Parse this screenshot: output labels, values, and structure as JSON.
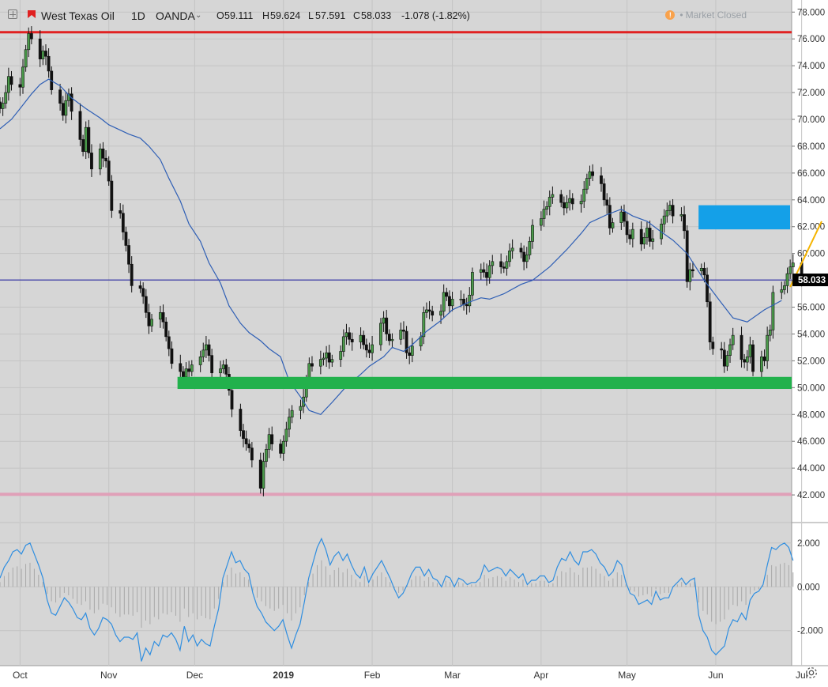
{
  "header": {
    "symbol": "West Texas Oil",
    "interval": "1D",
    "broker": "OANDA",
    "open_label": "O",
    "open": "59.111",
    "high_label": "H",
    "high": "59.624",
    "low_label": "L",
    "low": "57.591",
    "close_label": "C",
    "close": "58.033",
    "change": "-1.078 (-1.82%)",
    "market_status": "Market Closed"
  },
  "colors": {
    "background": "#d6d6d6",
    "candle_up": "#4a9a4a",
    "candle_down": "#111111",
    "ma_line": "#2f5fb5",
    "price_line": "#1a1aa0",
    "resistance_line": "#e02020",
    "support_band": "#22b14c",
    "target_box": "#14a0e8",
    "bottom_line": "#e0a0b8",
    "oscillator_line": "#2f8ee0",
    "oscillator_hist": "#a8a8a8",
    "projection_line": "#f5b400",
    "price_badge_bg": "#000000"
  },
  "chart_data": [
    {
      "type": "candlestick",
      "title": "",
      "y_axis_ticks": [
        "42.000",
        "44.000",
        "46.000",
        "48.000",
        "50.000",
        "52.000",
        "54.000",
        "56.000",
        "58.000",
        "60.000",
        "62.000",
        "64.000",
        "66.000",
        "68.000",
        "70.000",
        "72.000",
        "74.000",
        "76.000",
        "78.000"
      ],
      "x_axis_ticks": [
        "Oct",
        "Nov",
        "Dec",
        "2019",
        "Feb",
        "Mar",
        "Apr",
        "May",
        "Jun",
        "Jul"
      ],
      "ylim": [
        40.0,
        78.9
      ],
      "current_price": 58.033,
      "current_price_label": "58.033",
      "horizontal_levels": {
        "resistance": 76.5,
        "price_line": 58.03,
        "bottom": 42.05
      },
      "support_zone": [
        49.9,
        50.8
      ],
      "target_zone": [
        61.8,
        63.6
      ],
      "moving_average": [
        69.3,
        70.0,
        70.8,
        71.9,
        72.6,
        73.0,
        72.5,
        71.6,
        70.8,
        70.1,
        69.6,
        69.2,
        68.9,
        68.6,
        68.0,
        67.0,
        65.6,
        63.9,
        62.2,
        60.9,
        59.3,
        57.8,
        56.1,
        54.8,
        54.1,
        53.5,
        52.9,
        52.3,
        50.5,
        49.3,
        48.3,
        48.0,
        48.9,
        50.1,
        51.0,
        51.6,
        52.3,
        53.0,
        52.7,
        53.2,
        54.2,
        55.0,
        55.8,
        56.3,
        56.7,
        56.6,
        57.0,
        57.7,
        58.0,
        59.0,
        60.3,
        61.5,
        62.3,
        62.9,
        63.3,
        62.8,
        62.4,
        61.6,
        61.0,
        60.0,
        58.0,
        56.3,
        55.2,
        54.9,
        55.8,
        56.5
      ],
      "ma_x_dates": [
        "2018-09-24",
        "2018-09-28",
        "2018-10-01",
        "2018-10-05",
        "2018-10-08",
        "2018-10-11",
        "2018-10-15",
        "2018-10-19",
        "2018-10-24",
        "2018-10-29",
        "2018-11-01",
        "2018-11-05",
        "2018-11-08",
        "2018-11-12",
        "2018-11-15",
        "2018-11-19",
        "2018-11-22",
        "2018-11-26",
        "2018-11-29",
        "2018-12-03",
        "2018-12-06",
        "2018-12-10",
        "2018-12-13",
        "2018-12-17",
        "2018-12-20",
        "2018-12-24",
        "2018-12-27",
        "2018-12-31",
        "2019-01-03",
        "2019-01-07",
        "2019-01-10",
        "2019-01-14",
        "2019-01-18",
        "2019-01-23",
        "2019-01-28",
        "2019-01-31",
        "2019-02-05",
        "2019-02-08",
        "2019-02-12",
        "2019-02-15",
        "2019-02-20",
        "2019-02-25",
        "2019-03-01",
        "2019-03-06",
        "2019-03-11",
        "2019-03-14",
        "2019-03-19",
        "2019-03-25",
        "2019-03-29",
        "2019-04-04",
        "2019-04-10",
        "2019-04-15",
        "2019-04-18",
        "2019-04-24",
        "2019-04-29",
        "2019-05-03",
        "2019-05-08",
        "2019-05-13",
        "2019-05-17",
        "2019-05-22",
        "2019-05-28",
        "2019-06-03",
        "2019-06-07",
        "2019-06-12",
        "2019-06-18",
        "2019-06-24"
      ],
      "candles_date_start": "2018-09-24",
      "candles_close": [
        70.8,
        71.2,
        72.0,
        73.2,
        72.6,
        72.4,
        73.9,
        75.2,
        76.4,
        76.0,
        74.5,
        75.1,
        74.7,
        73.6,
        72.2,
        71.2,
        70.3,
        71.4,
        71.9,
        70.6,
        68.5,
        67.6,
        69.4,
        67.5,
        66.3,
        67.8,
        67.1,
        66.9,
        65.4,
        63.2,
        63.0,
        61.6,
        60.6,
        59.2,
        57.6,
        57.4,
        56.8,
        55.6,
        54.6,
        55.1,
        55.6,
        54.9,
        53.8,
        52.9,
        51.8,
        51.2,
        50.8,
        51.4,
        51.2,
        51.7,
        52.3,
        52.8,
        53.2,
        52.4,
        51.1,
        51.4,
        51.7,
        51.0,
        49.8,
        48.4,
        46.8,
        46.2,
        45.8,
        45.5,
        44.6,
        42.5,
        44.5,
        45.4,
        46.5,
        45.8,
        45.1,
        46.0,
        46.9,
        47.8,
        48.3,
        48.6,
        49.3,
        50.6,
        51.8,
        51.6,
        52.1,
        52.2,
        52.6,
        51.9,
        52.1,
        52.7,
        53.8,
        54.1,
        53.6,
        53.4,
        53.9,
        53.2,
        52.8,
        52.6,
        53.2,
        54.8,
        55.2,
        54.0,
        53.5,
        53.6,
        54.3,
        54.2,
        52.6,
        52.4,
        53.1,
        53.8,
        55.6,
        55.8,
        55.7,
        55.4,
        55.7,
        57.1,
        56.8,
        56.1,
        56.6,
        56.6,
        56.2,
        56.1,
        56.9,
        58.6,
        58.8,
        58.6,
        58.2,
        59.1,
        59.4,
        59.0,
        58.9,
        59.4,
        60.2,
        60.4,
        60.1,
        59.4,
        59.9,
        60.9,
        62.1,
        62.6,
        63.3,
        63.5,
        64.2,
        64.4,
        63.8,
        63.4,
        63.8,
        64.1,
        63.7,
        63.9,
        64.8,
        65.6,
        66.1,
        65.8,
        65.2,
        64.0,
        63.6,
        61.9,
        62.3,
        63.1,
        62.4,
        61.4,
        61.1,
        61.8,
        60.7,
        61.2,
        61.9,
        60.9,
        61.1,
        62.2,
        62.8,
        63.2,
        63.6,
        62.8,
        62.9,
        61.7,
        57.9,
        58.8,
        58.7,
        58.9,
        58.4,
        56.4,
        53.4,
        52.9,
        52.8,
        51.6,
        52.4,
        53.2,
        53.9,
        52.1,
        51.9,
        52.3,
        53.2,
        51.2,
        52.3,
        52.0,
        53.9,
        54.3,
        57.1,
        57.3,
        57.6,
        58.5,
        59.0,
        59.3,
        58.0
      ],
      "sub_pane": {
        "type": "oscillator",
        "y_axis_ticks": [
          "2.000",
          "0.000",
          "-2.000"
        ],
        "ylim": [
          -3.6,
          2.9
        ],
        "values": [
          0.4,
          0.9,
          1.2,
          1.6,
          1.7,
          1.5,
          1.9,
          2.0,
          1.5,
          1.0,
          0.4,
          -0.6,
          -1.2,
          -1.3,
          -0.9,
          -0.5,
          -0.7,
          -1.0,
          -1.4,
          -1.5,
          -1.2,
          -1.9,
          -2.2,
          -1.9,
          -1.4,
          -1.5,
          -1.7,
          -2.2,
          -2.5,
          -2.3,
          -2.3,
          -2.4,
          -2.1,
          -3.4,
          -2.8,
          -3.1,
          -2.5,
          -2.7,
          -2.2,
          -2.3,
          -2.1,
          -2.4,
          -2.9,
          -1.8,
          -2.5,
          -2.2,
          -2.7,
          -2.4,
          -2.6,
          -2.7,
          -1.8,
          -1.0,
          0.4,
          1.0,
          1.6,
          1.1,
          1.2,
          0.8,
          0.6,
          -0.3,
          -0.9,
          -1.2,
          -1.6,
          -1.8,
          -2.0,
          -1.8,
          -1.5,
          -2.2,
          -2.8,
          -2.2,
          -1.7,
          -0.7,
          0.4,
          1.1,
          1.8,
          2.2,
          1.7,
          1.0,
          1.4,
          1.6,
          1.2,
          1.5,
          1.0,
          0.6,
          0.4,
          0.9,
          0.2,
          0.6,
          0.9,
          1.2,
          0.8,
          0.4,
          -0.1,
          -0.5,
          -0.3,
          0.1,
          0.6,
          0.9,
          0.9,
          0.5,
          0.8,
          0.4,
          0.3,
          0.0,
          0.5,
          0.4,
          0.0,
          0.4,
          0.3,
          0.1,
          0.2,
          0.2,
          0.4,
          1.0,
          0.7,
          0.8,
          0.9,
          0.8,
          0.5,
          0.8,
          0.6,
          0.4,
          0.6,
          0.1,
          0.3,
          0.3,
          0.5,
          0.5,
          0.2,
          0.3,
          0.9,
          1.3,
          1.2,
          1.6,
          1.2,
          1.0,
          1.6,
          1.6,
          1.7,
          1.5,
          1.1,
          0.9,
          0.5,
          0.7,
          1.2,
          1.0,
          0.2,
          -0.3,
          -0.4,
          -0.8,
          -0.7,
          -0.6,
          -0.8,
          -0.2,
          -0.6,
          -0.5,
          -0.5,
          0.0,
          0.2,
          0.4,
          0.1,
          0.3,
          0.4,
          -1.3,
          -2.0,
          -2.3,
          -2.9,
          -3.1,
          -2.9,
          -2.7,
          -1.9,
          -1.5,
          -1.6,
          -1.2,
          -1.5,
          -0.6,
          -0.3,
          -0.2,
          0.1,
          1.0,
          1.8,
          1.7,
          1.9,
          2.0,
          1.8,
          1.2
        ]
      }
    }
  ]
}
